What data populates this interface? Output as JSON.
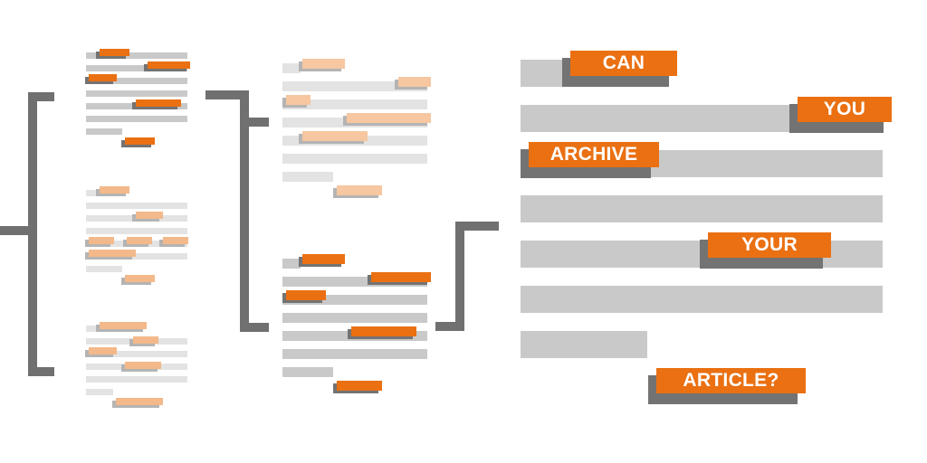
{
  "words": [
    "CAN",
    "YOU",
    "ARCHIVE",
    "YOUR",
    "ARTICLE?"
  ],
  "colors": {
    "accent": "#ea7012",
    "accent_light": "#f3b98a",
    "accent_pale": "#f6c7a0",
    "shadow": "#737373",
    "shadow_light": "#b4b4b4",
    "line": "#c9c9c9",
    "line_light": "#e3e3e3",
    "bracket": "#707070"
  }
}
